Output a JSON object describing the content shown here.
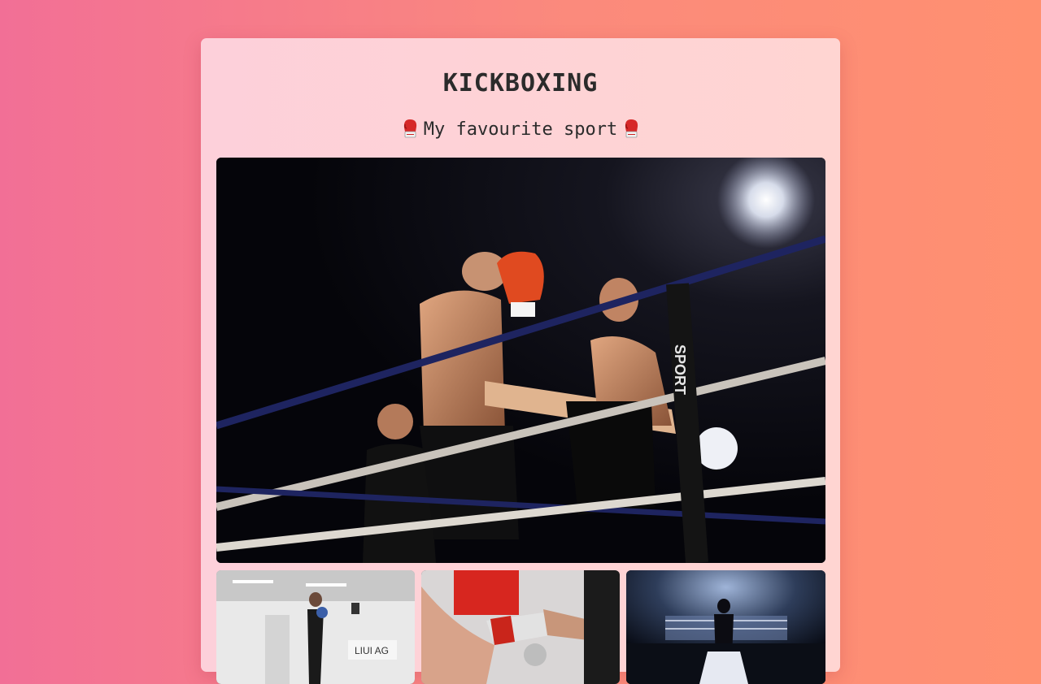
{
  "page": {
    "title": "KICKBOXING",
    "subtitle": "My favourite sport",
    "subtitle_icon": "boxing-glove-icon"
  },
  "photos": {
    "main": {
      "subject": "Kickboxing match in ring with referee",
      "corner_text": "SPORT"
    },
    "thumbnails": [
      {
        "subject": "Woman training with punching bag in gym",
        "sign_text": "LIUI AG"
      },
      {
        "subject": "Hands wrapping boxing tape"
      },
      {
        "subject": "Boxer walking toward lit ring in arena"
      }
    ]
  },
  "colors": {
    "accent": "#f26f96",
    "accent_end": "#ff9070",
    "card": "#fdd0da"
  }
}
